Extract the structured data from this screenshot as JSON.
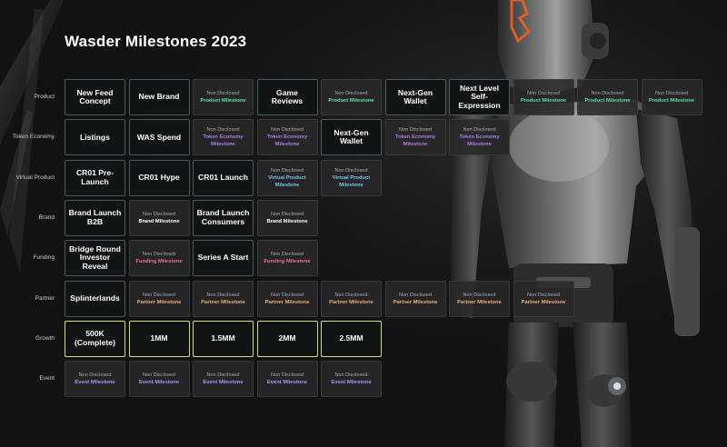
{
  "title": "Wasder Milestones 2023",
  "colors": {
    "background": "#121212",
    "main_border": "#4a5a5f",
    "product": "#5ee0a6",
    "token_economy": "#b07be8",
    "virtual_product": "#6fc4ef",
    "brand": "#ffffff",
    "funding": "#ef6f8f",
    "partner": "#f2aa6a",
    "growth_border": "#d2de7e",
    "event": "#9a9cf6"
  },
  "rows": [
    {
      "label": "Product",
      "tiles": [
        {
          "type": "main",
          "text": "New Feed Concept"
        },
        {
          "type": "main",
          "text": "New Brand"
        },
        {
          "type": "nd",
          "top": "Non Disclosed",
          "bottom": "Product Milestone",
          "color": "#5ee0a6"
        },
        {
          "type": "main",
          "text": "Game Reviews"
        },
        {
          "type": "nd",
          "top": "Non Disclosed",
          "bottom": "Product Milestone",
          "color": "#5ee0a6"
        },
        {
          "type": "main",
          "text": "Next-Gen Wallet"
        },
        {
          "type": "main",
          "text": "Next Level Self-Expression"
        },
        {
          "type": "nd",
          "top": "Non Disclosed",
          "bottom": "Product Milestone",
          "color": "#5ee0a6"
        },
        {
          "type": "nd",
          "top": "Non Disclosed",
          "bottom": "Product Milestone",
          "color": "#5ee0a6"
        },
        {
          "type": "nd",
          "top": "Non Disclosed",
          "bottom": "Product Milestone",
          "color": "#5ee0a6"
        }
      ]
    },
    {
      "label": "Token Economy",
      "tiles": [
        {
          "type": "main",
          "text": "Listings"
        },
        {
          "type": "main",
          "text": "WAS Spend"
        },
        {
          "type": "nd",
          "top": "Non Disclosed",
          "bottom": "Token Economy Milestone",
          "color": "#b07be8"
        },
        {
          "type": "nd",
          "top": "Non Disclosed",
          "bottom": "Token Economy Milestone",
          "color": "#b07be8"
        },
        {
          "type": "main",
          "text": "Next-Gen Wallet"
        },
        {
          "type": "nd",
          "top": "Non Disclosed",
          "bottom": "Token Economy Milestone",
          "color": "#b07be8"
        },
        {
          "type": "nd",
          "top": "Non Disclosed",
          "bottom": "Token Economy Milestone",
          "color": "#b07be8"
        }
      ]
    },
    {
      "label": "Virtual Product",
      "tiles": [
        {
          "type": "main",
          "text": "CR01 Pre-Launch"
        },
        {
          "type": "main",
          "text": "CR01 Hype"
        },
        {
          "type": "main",
          "text": "CR01 Launch"
        },
        {
          "type": "nd",
          "top": "Non Disclosed",
          "bottom": "Virtual Product Milestone",
          "color": "#6fc4ef"
        },
        {
          "type": "nd",
          "top": "Non Disclosed",
          "bottom": "Virtual Product Milestone",
          "color": "#6fc4ef"
        }
      ]
    },
    {
      "label": "Brand",
      "tiles": [
        {
          "type": "main",
          "text": "Brand Launch B2B"
        },
        {
          "type": "nd",
          "top": "Non Disclosed",
          "bottom": "Brand Milestone",
          "color": "#ffffff"
        },
        {
          "type": "main",
          "text": "Brand Launch Consumers"
        },
        {
          "type": "nd",
          "top": "Non Disclosed",
          "bottom": "Brand Milestone",
          "color": "#ffffff"
        }
      ]
    },
    {
      "label": "Funding",
      "tiles": [
        {
          "type": "main",
          "text": "Bridge Round Investor Reveal"
        },
        {
          "type": "nd",
          "top": "Non Disclosed",
          "bottom": "Funding Milestone",
          "color": "#ef6f8f"
        },
        {
          "type": "main",
          "text": "Series A Start"
        },
        {
          "type": "nd",
          "top": "Non Disclosed",
          "bottom": "Funding Milestone",
          "color": "#ef6f8f"
        }
      ]
    },
    {
      "label": "Partner",
      "tiles": [
        {
          "type": "main",
          "text": "Splinterlands"
        },
        {
          "type": "nd",
          "top": "Non Disclosed",
          "bottom": "Partner Milestone",
          "color": "#f2aa6a"
        },
        {
          "type": "nd",
          "top": "Non Disclosed",
          "bottom": "Partner Milestone",
          "color": "#f2aa6a"
        },
        {
          "type": "nd",
          "top": "Non Disclosed",
          "bottom": "Partner Milestone",
          "color": "#f2aa6a"
        },
        {
          "type": "nd",
          "top": "Non Disclosed",
          "bottom": "Partner Milestone",
          "color": "#f2aa6a"
        },
        {
          "type": "nd",
          "top": "Non Disclosed",
          "bottom": "Partner Milestone",
          "color": "#f2aa6a"
        },
        {
          "type": "nd",
          "top": "Non Disclosed",
          "bottom": "Partner Milestone",
          "color": "#f2aa6a"
        },
        {
          "type": "nd",
          "top": "Non Disclosed",
          "bottom": "Partner Milestone",
          "color": "#f2aa6a"
        }
      ]
    },
    {
      "label": "Growth",
      "tiles": [
        {
          "type": "main",
          "text": "500K (Complete)",
          "accent": "#d2de7e"
        },
        {
          "type": "main",
          "text": "1MM",
          "accent": "#d2de7e"
        },
        {
          "type": "main",
          "text": "1.5MM",
          "accent": "#d2de7e"
        },
        {
          "type": "main",
          "text": "2MM",
          "accent": "#d2de7e"
        },
        {
          "type": "main",
          "text": "2.5MM",
          "accent": "#d2de7e"
        }
      ]
    },
    {
      "label": "Event",
      "tiles": [
        {
          "type": "nd",
          "top": "Non Disclosed",
          "bottom": "Event Milestone",
          "color": "#9a9cf6"
        },
        {
          "type": "nd",
          "top": "Non Disclosed",
          "bottom": "Event Milestone",
          "color": "#9a9cf6"
        },
        {
          "type": "nd",
          "top": "Non Disclosed",
          "bottom": "Event Milestone",
          "color": "#9a9cf6"
        },
        {
          "type": "nd",
          "top": "Non Disclosed",
          "bottom": "Event Milestone",
          "color": "#9a9cf6"
        },
        {
          "type": "nd",
          "top": "Non Disclosed",
          "bottom": "Event Milestone",
          "color": "#9a9cf6"
        }
      ]
    }
  ]
}
